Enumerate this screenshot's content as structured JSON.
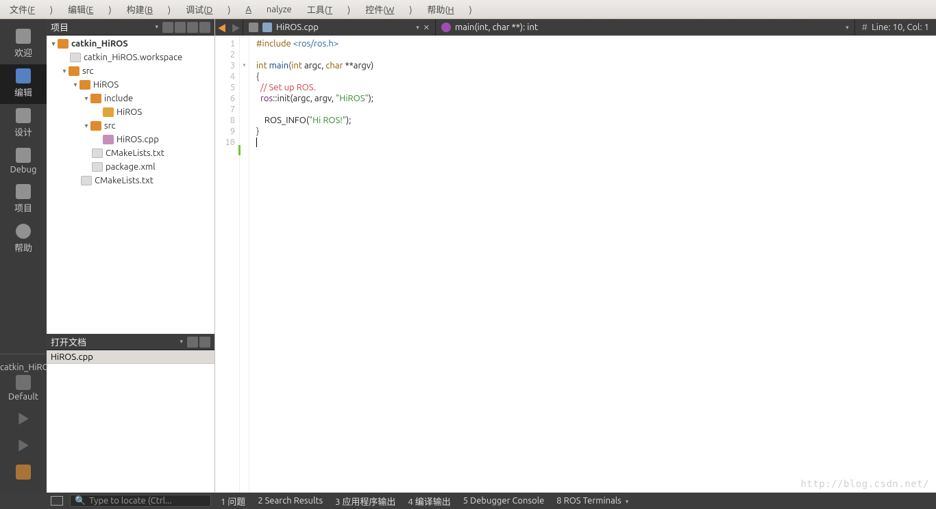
{
  "menu": {
    "file": "文件(F)",
    "edit": "编辑(E)",
    "build": "构建(B)",
    "debug": "调试(D)",
    "analyze": "Analyze",
    "tools": "工具(T)",
    "widgets": "控件(W)",
    "help": "帮助(H)"
  },
  "modes": {
    "welcome": "欢迎",
    "edit": "编辑",
    "design": "设计",
    "debug": "Debug",
    "project": "项目",
    "help": "帮助",
    "target": "catkin_HiROS",
    "kit": "Default"
  },
  "project_panel": {
    "title": "项目"
  },
  "tree": {
    "root": "catkin_HiROS",
    "ws": "catkin_HiROS.workspace",
    "src": "src",
    "hiros": "HiROS",
    "include": "include",
    "include_hiros": "HiROS",
    "src2": "src",
    "file_cpp": "HiROS.cpp",
    "cmake": "CMakeLists.txt",
    "pkg": "package.xml",
    "cmake2": "CMakeLists.txt"
  },
  "opendocs": {
    "title": "打开文档",
    "item": "HiROS.cpp"
  },
  "tabs": {
    "file": "HiROS.cpp",
    "func": "main(int, char **): int",
    "line": "Line: 10, Col: 1"
  },
  "code": {
    "l1a": "#include ",
    "l1b": "<ros/ros.h>",
    "l3a": "int ",
    "l3b": "main",
    "l3c": "(",
    "l3d": "int ",
    "l3e": "argc, ",
    "l3f": "char ",
    "l3g": "**argv)",
    "l4": "{",
    "l5": "  // Set up ROS.",
    "l6a": "  ros",
    "l6b": "::",
    "l6c": "init",
    "l6d": "(argc, argv, ",
    "l6e": "\"HiROS\"",
    "l6f": ");",
    "l8a": "    ROS_INFO",
    "l8b": "(",
    "l8c": "\"Hi ROS!\"",
    "l8d": ");",
    "l9": "}"
  },
  "status": {
    "search": "Type to locate (Ctrl...",
    "o1": "1  问题",
    "o2": "2  Search Results",
    "o3": "3  应用程序输出",
    "o4": "4  编译输出",
    "o5": "5  Debugger Console",
    "o6": "8  ROS Terminals"
  },
  "watermark": "http://blog.csdn.net/"
}
